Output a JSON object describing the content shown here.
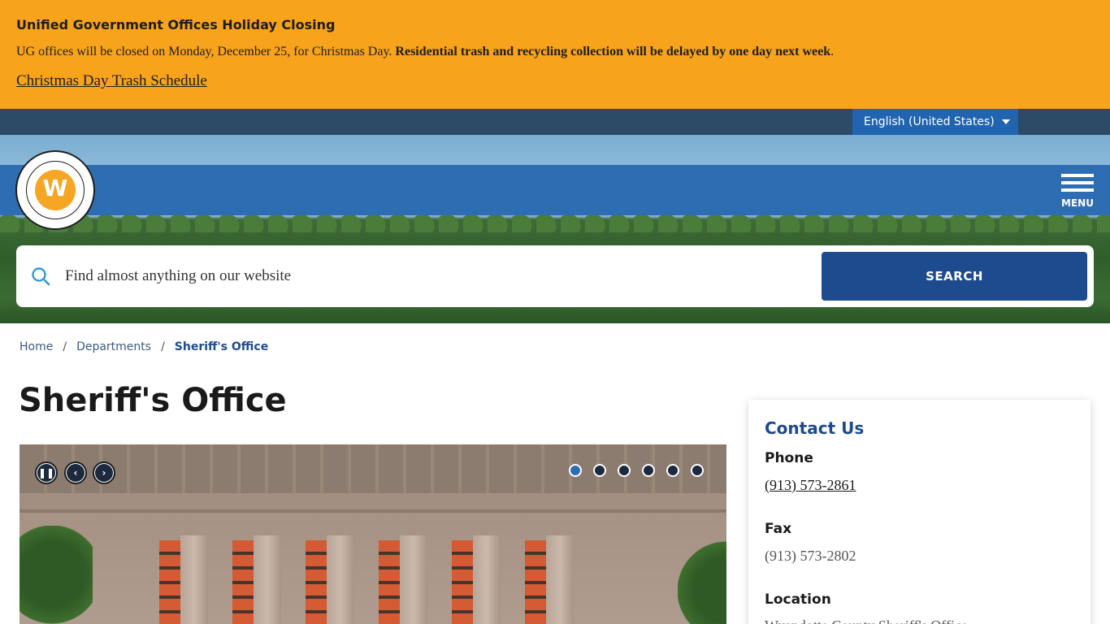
{
  "alert": {
    "title": "Unified Government Offices Holiday Closing",
    "body_plain": "UG offices will be closed on Monday, December 25, for Christmas Day. ",
    "body_bold": "Residential trash and recycling collection will be delayed by one day next week",
    "body_end": ".",
    "link": "Christmas Day Trash Schedule",
    "color": "#f7a31c"
  },
  "language": {
    "selected": "English (United States)"
  },
  "header": {
    "menu_label": "MENU",
    "brand_color": "#2f6db3"
  },
  "search": {
    "placeholder": "Find almost anything on our website",
    "button_label": "SEARCH"
  },
  "breadcrumb": {
    "items": [
      "Home",
      "Departments",
      "Sheriff's Office"
    ],
    "separator": "/"
  },
  "page": {
    "title": "Sheriff's Office"
  },
  "slideshow": {
    "controls": [
      "pause-icon",
      "chevron-left-icon",
      "chevron-right-icon"
    ],
    "slide_count": 6,
    "active_index": 0
  },
  "contact": {
    "title": "Contact Us",
    "phone_label": "Phone",
    "phone": "(913) 573-2861",
    "fax_label": "Fax",
    "fax": "(913) 573-2802",
    "location_label": "Location",
    "location_partial": "Wyandotte County Sheriff's Office"
  }
}
